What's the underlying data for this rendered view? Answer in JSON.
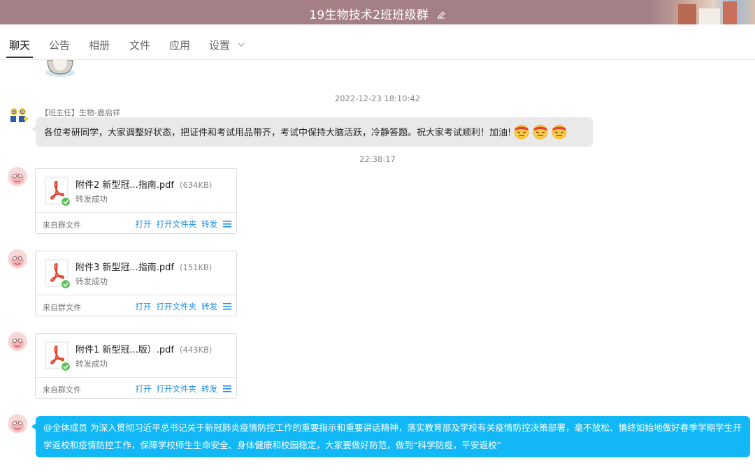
{
  "window": {
    "title": "19生物技术2班班级群",
    "edit_icon": "pencil-icon",
    "title_bar_color": "#a57f86"
  },
  "tabs": [
    {
      "label": "聊天",
      "active": true
    },
    {
      "label": "公告"
    },
    {
      "label": "相册"
    },
    {
      "label": "文件"
    },
    {
      "label": "应用"
    },
    {
      "label": "设置",
      "icon": "chevron-down-icon"
    }
  ],
  "messages": {
    "timestamp_1": "2022-12-23 18:10:42",
    "teacher": {
      "sender": "【班主任】生物-鹿启祥",
      "text": "各位考研同学，大家调整好状态，把证件和考试用品带齐，考试中保持大脑活跃，冷静答题。祝大家考试顺利！加油!",
      "emojis": [
        "determined-face-emoji",
        "determined-face-emoji",
        "determined-face-emoji"
      ]
    },
    "timestamp_2": "22:38:17",
    "files": [
      {
        "name": "附件2 新型冠...指南.pdf",
        "size": "(634KB)",
        "status": "转发成功",
        "from": "来自群文件",
        "actions": [
          "打开",
          "打开文件夹",
          "转发"
        ]
      },
      {
        "name": "附件3 新型冠...指南.pdf",
        "size": "(151KB)",
        "status": "转发成功",
        "from": "来自群文件",
        "actions": [
          "打开",
          "打开文件夹",
          "转发"
        ]
      },
      {
        "name": "附件1 新型冠...版）.pdf",
        "size": "(443KB)",
        "status": "转发成功",
        "from": "来自群文件",
        "actions": [
          "打开",
          "打开文件夹",
          "转发"
        ]
      }
    ],
    "announcement": {
      "mention": "@全体成员",
      "text": "为深入贯彻习近平总书记关于新冠肺炎疫情防控工作的重要指示和重要讲话精神，落实教育部及学校有关疫情防控决策部署，毫不放松、慎终如始地做好春季学期学生开学返校和疫情防控工作，保障学校师生生命安全、身体健康和校园稳定，大家要做好防范，做到“科学防疫，平安返校”",
      "bubble_color": "#12b7f5"
    }
  },
  "colors": {
    "link": "#1b8fe6",
    "success": "#5cc15c",
    "pdf_red": "#e2452f"
  }
}
